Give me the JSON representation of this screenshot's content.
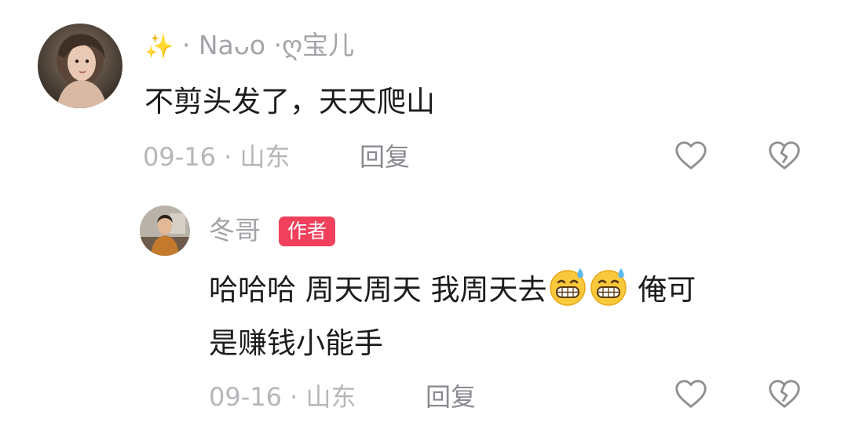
{
  "comments": [
    {
      "user": {
        "sparkle": "✨",
        "name": "· Naᴗo ·ღ宝儿"
      },
      "text": "不剪头发了，天天爬山",
      "date": "09-16 · 山东",
      "reply_label": "回复"
    },
    {
      "user": {
        "name": "冬哥",
        "badge": "作者"
      },
      "text_line1": "哈哈哈 周天周天 我周天去",
      "text_line1_tail": " 俺可",
      "text_line2": "是赚钱小能手",
      "emojis": [
        "grin-sweat-emoji",
        "grin-sweat-emoji"
      ],
      "date": "09-16 · 山东",
      "reply_label": "回复"
    }
  ],
  "icons": {
    "like": "heart-outline-icon",
    "dislike": "broken-heart-outline-icon"
  },
  "colors": {
    "badge": "#f0405c",
    "name": "#a3a3a8",
    "meta": "#b5b5ba",
    "text": "#1c1c1e"
  }
}
